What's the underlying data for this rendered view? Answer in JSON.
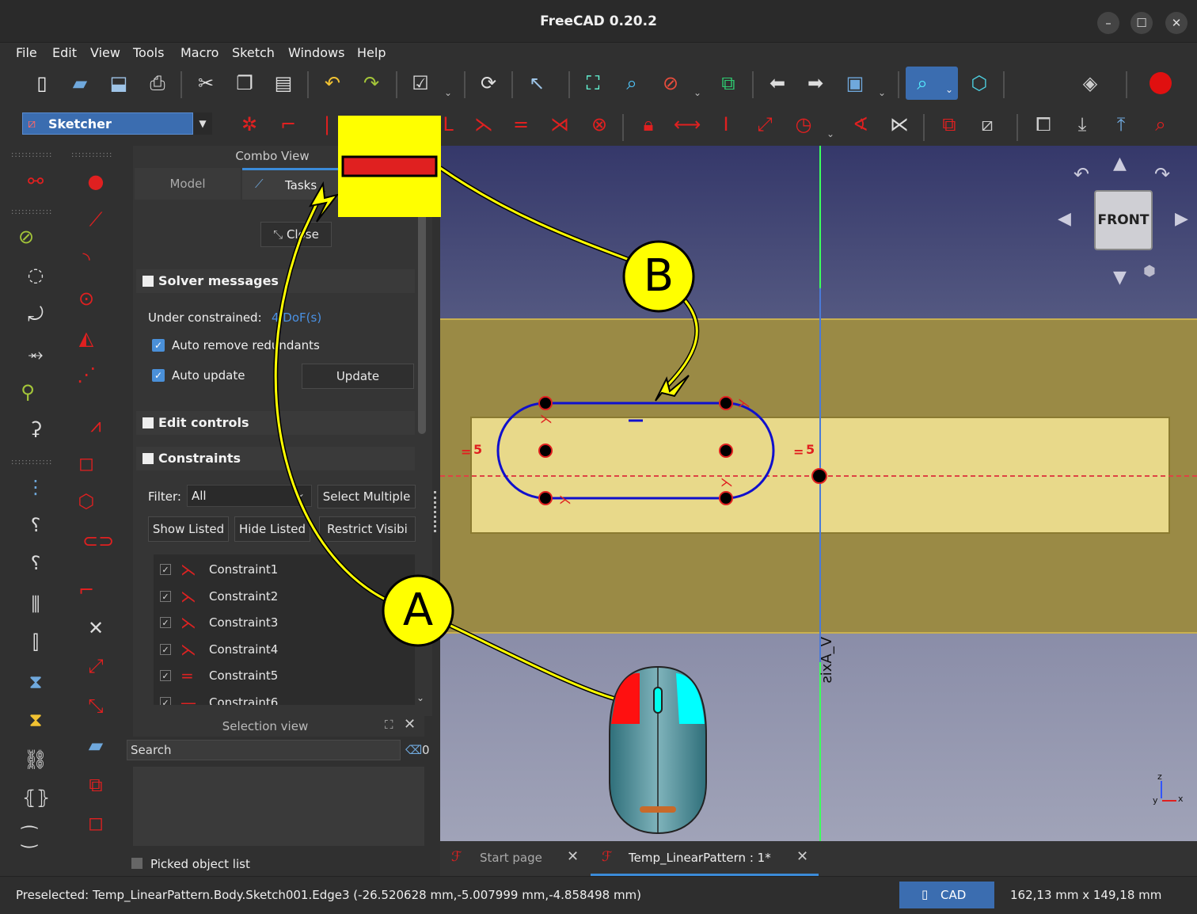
{
  "window": {
    "title": "FreeCAD 0.20.2",
    "minimize": "–",
    "maximize": "☐",
    "close": "✕"
  },
  "menu": [
    "File",
    "Edit",
    "View",
    "Tools",
    "Macro",
    "Sketch",
    "Windows",
    "Help"
  ],
  "workbench": {
    "label": "Sketcher"
  },
  "combo": {
    "title": "Combo View",
    "tab_model": "Model",
    "tab_tasks": "Tasks",
    "close_button": "Close",
    "solver": {
      "header": "Solver messages",
      "under_constrained_label": "Under constrained:",
      "dof_link": "4 DoF(s)",
      "auto_remove": "Auto remove redundants",
      "auto_update": "Auto update",
      "update_button": "Update"
    },
    "edit_controls": "Edit controls",
    "constraints": {
      "header": "Constraints",
      "filter_label": "Filter:",
      "filter_value": "All",
      "select_multiple": "Select Multiple",
      "show_listed": "Show Listed",
      "hide_listed": "Hide Listed",
      "restrict_visibility": "Restrict Visibi",
      "items": [
        "Constraint1",
        "Constraint2",
        "Constraint3",
        "Constraint4",
        "Constraint5",
        "Constraint6"
      ]
    }
  },
  "selection_view": {
    "title": "Selection view",
    "search_placeholder": "Search",
    "count": "0",
    "picked_list": "Picked object list"
  },
  "viewport": {
    "navcube_face": "FRONT",
    "axis_label": "V_Axis",
    "dim_left": "5",
    "dim_right": "5",
    "axes": {
      "z": "z",
      "y": "y",
      "x": "x"
    }
  },
  "annotations": {
    "a": "A",
    "b": "B"
  },
  "doc_tabs": [
    "Start page",
    "Temp_LinearPattern : 1*"
  ],
  "status": {
    "preselected": "Preselected: Temp_LinearPattern.Body.Sketch001.Edge3 (-26.520628 mm,-5.007999 mm,-4.858498 mm)",
    "nav_style": "CAD",
    "dimensions": "162,13 mm x 149,18 mm"
  },
  "colors": {
    "accent": "#3b6db0",
    "constraint_red": "#e02020",
    "sketch_blue": "#1010cc",
    "highlight_yellow": "#ffff00",
    "pad_face": "#e8d98a"
  }
}
